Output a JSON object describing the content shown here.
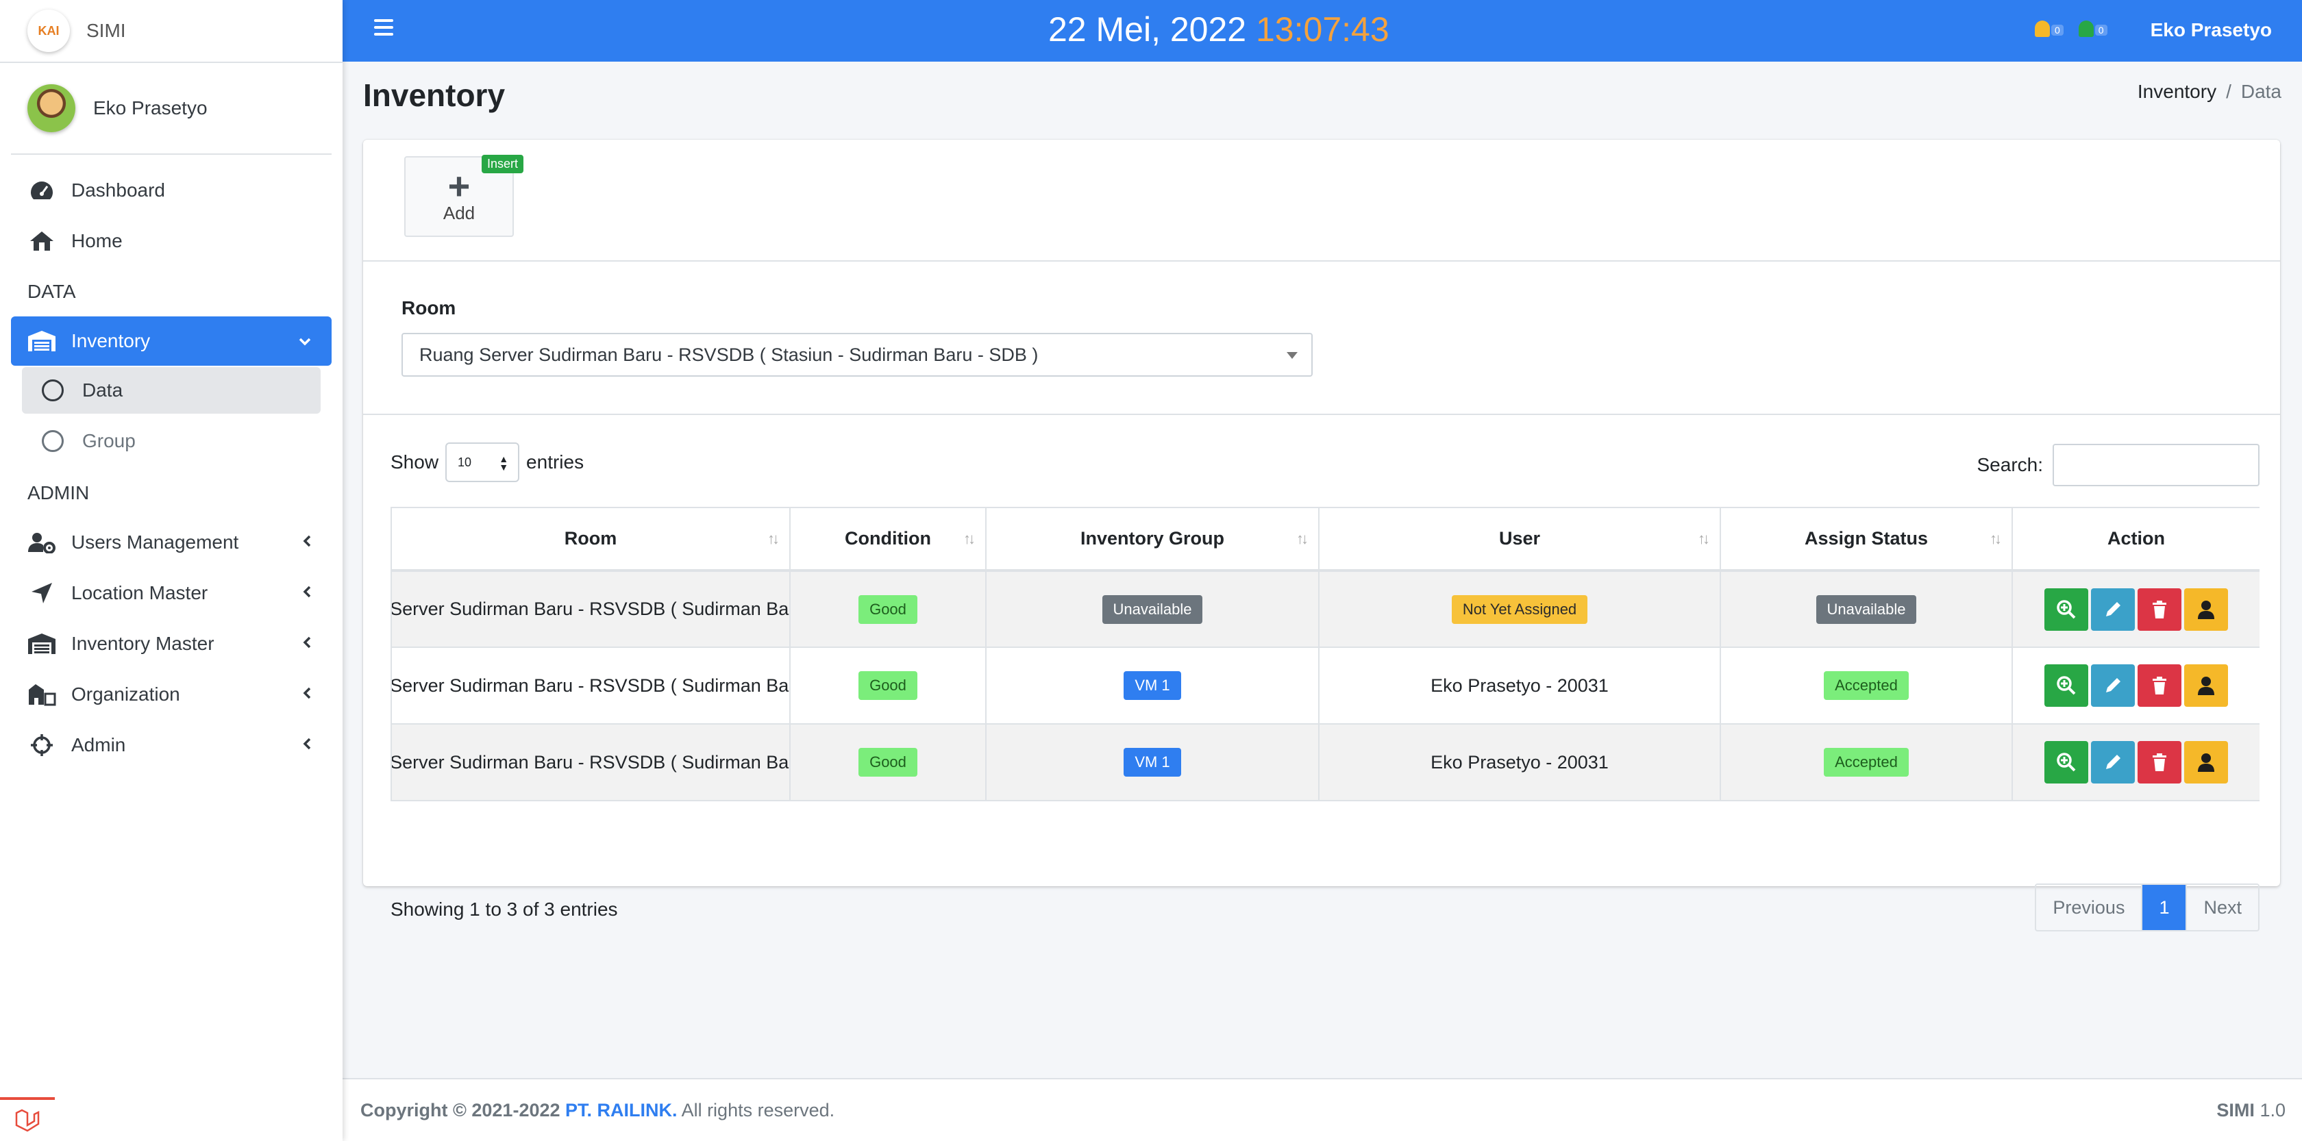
{
  "brand": {
    "logo_text": "KAI",
    "name": "SIMI"
  },
  "user": {
    "name": "Eko Prasetyo"
  },
  "sidebar": {
    "items": [
      {
        "label": "Dashboard",
        "icon": "tachometer-icon"
      },
      {
        "label": "Home",
        "icon": "home-icon"
      }
    ],
    "header_data": "DATA",
    "inventory": {
      "label": "Inventory",
      "icon": "warehouse-icon"
    },
    "sub": [
      {
        "label": "Data"
      },
      {
        "label": "Group"
      }
    ],
    "header_admin": "ADMIN",
    "admin_items": [
      {
        "label": "Users Management",
        "icon": "user-cog-icon"
      },
      {
        "label": "Location Master",
        "icon": "location-arrow-icon"
      },
      {
        "label": "Inventory Master",
        "icon": "warehouse-icon"
      },
      {
        "label": "Organization",
        "icon": "building-icon"
      },
      {
        "label": "Admin",
        "icon": "crosshairs-icon"
      }
    ]
  },
  "topbar": {
    "date": "22 Mei, 2022",
    "time": "13:07:43",
    "notif_count_1": "0",
    "notif_count_2": "0",
    "user": "Eko Prasetyo"
  },
  "page": {
    "title": "Inventory",
    "breadcrumb": [
      "Inventory",
      "Data"
    ]
  },
  "toolbar": {
    "add_label": "Add",
    "insert_badge": "Insert"
  },
  "room_filter": {
    "label": "Room",
    "value": "Ruang Server Sudirman Baru - RSVSDB ( Stasiun - Sudirman Baru - SDB )"
  },
  "table": {
    "show_label": "Show",
    "entries_label": "entries",
    "page_length": "10",
    "search_label": "Search:",
    "columns": [
      "Room",
      "Condition",
      "Inventory Group",
      "User",
      "Assign Status",
      "Action"
    ],
    "rows": [
      {
        "room": "Ruang Server Sudirman Baru - RSVSDB ( Sudirman Baru - SDB )",
        "condition": "Good",
        "group": "Unavailable",
        "user": "Not Yet Assigned",
        "status": "Unavailable"
      },
      {
        "room": "Ruang Server Sudirman Baru - RSVSDB ( Sudirman Baru - SDB )",
        "condition": "Good",
        "group": "VM 1",
        "user": "Eko Prasetyo - 20031",
        "status": "Accepted"
      },
      {
        "room": "Ruang Server Sudirman Baru - RSVSDB ( Sudirman Baru - SDB )",
        "condition": "Good",
        "group": "VM 1",
        "user": "Eko Prasetyo - 20031",
        "status": "Accepted"
      }
    ],
    "info": "Showing 1 to 3 of 3 entries",
    "pagination": {
      "previous": "Previous",
      "current": "1",
      "next": "Next"
    }
  },
  "footer": {
    "copyright": "Copyright © 2021-2022",
    "company": "PT. RAILINK.",
    "rights": "All rights reserved.",
    "app": "SIMI",
    "version": "1.0"
  },
  "colors": {
    "primary": "#2f7ef0",
    "clock_time": "#f5a23d",
    "success": "#28a745",
    "danger": "#dc3545",
    "warning": "#f5b829",
    "info": "#3ba1c9"
  }
}
